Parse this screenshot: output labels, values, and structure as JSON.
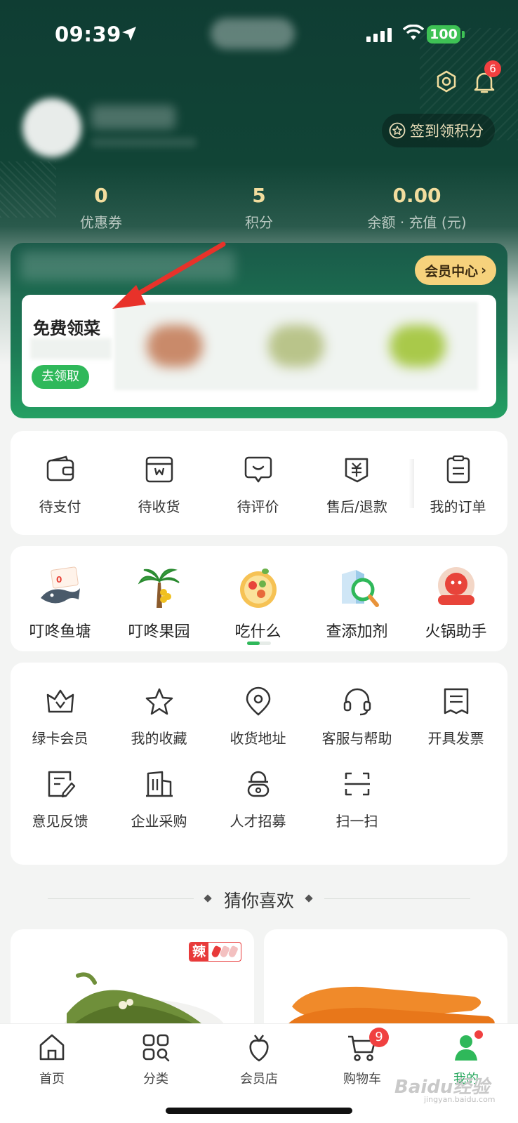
{
  "status_bar": {
    "time": "09:39",
    "battery": "100"
  },
  "header": {
    "notification_count": "6",
    "checkin_label": "签到领积分"
  },
  "stats": [
    {
      "value": "0",
      "label": "优惠券"
    },
    {
      "value": "5",
      "label": "积分"
    },
    {
      "value": "0.00",
      "label": "余额 · 充值 (元)"
    }
  ],
  "member": {
    "center_label": "会员中心",
    "free_title": "免费领菜",
    "free_button": "去领取"
  },
  "orders": [
    {
      "label": "待支付",
      "icon": "wallet-icon"
    },
    {
      "label": "待收货",
      "icon": "package-icon"
    },
    {
      "label": "待评价",
      "icon": "comment-icon"
    },
    {
      "label": "售后/退款",
      "icon": "refund-icon"
    },
    {
      "label": "我的订单",
      "icon": "order-list-icon"
    }
  ],
  "tools": [
    {
      "label": "叮咚鱼塘",
      "icon": "fish-pond-icon"
    },
    {
      "label": "叮咚果园",
      "icon": "orchard-icon"
    },
    {
      "label": "吃什么",
      "icon": "food-bowl-icon"
    },
    {
      "label": "查添加剂",
      "icon": "additive-check-icon"
    },
    {
      "label": "火锅助手",
      "icon": "hotpot-icon"
    }
  ],
  "services": [
    {
      "label": "绿卡会员",
      "icon": "crown-icon"
    },
    {
      "label": "我的收藏",
      "icon": "star-icon"
    },
    {
      "label": "收货地址",
      "icon": "location-icon"
    },
    {
      "label": "客服与帮助",
      "icon": "headset-icon"
    },
    {
      "label": "开具发票",
      "icon": "invoice-icon"
    },
    {
      "label": "意见反馈",
      "icon": "feedback-icon"
    },
    {
      "label": "企业采购",
      "icon": "building-icon"
    },
    {
      "label": "人才招募",
      "icon": "recruit-icon"
    },
    {
      "label": "扫一扫",
      "icon": "scan-icon"
    }
  ],
  "recommend": {
    "title": "猜你喜欢",
    "spicy_label": "辣"
  },
  "tabbar": [
    {
      "label": "首页",
      "icon": "home-icon"
    },
    {
      "label": "分类",
      "icon": "category-icon"
    },
    {
      "label": "会员店",
      "icon": "member-store-icon"
    },
    {
      "label": "购物车",
      "icon": "cart-icon"
    },
    {
      "label": "我的",
      "icon": "profile-icon"
    }
  ],
  "cart_count": "9",
  "watermark": {
    "brand": "Baidu经验",
    "url": "jingyan.baidu.com"
  },
  "colors": {
    "brand_green": "#2fb85a",
    "header_dark": "#0f3d33",
    "gold": "#f6d27c",
    "badge_red": "#f04040"
  }
}
